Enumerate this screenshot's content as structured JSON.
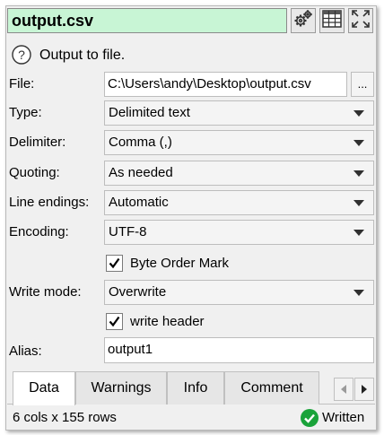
{
  "header": {
    "filename": "output.csv",
    "settings_icon": "gears-icon",
    "table_icon": "table-icon",
    "expand_icon": "expand-icon"
  },
  "info": {
    "help_icon": "question-mark-icon",
    "description": "Output to file."
  },
  "fields": {
    "file": {
      "label": "File:",
      "value": "C:\\Users\\andy\\Desktop\\output.csv",
      "browse_label": "..."
    },
    "type": {
      "label": "Type:",
      "value": "Delimited text"
    },
    "delimiter": {
      "label": "Delimiter:",
      "value": "Comma (,)"
    },
    "quoting": {
      "label": "Quoting:",
      "value": "As needed"
    },
    "line_endings": {
      "label": "Line endings:",
      "value": "Automatic"
    },
    "encoding": {
      "label": "Encoding:",
      "value": "UTF-8"
    },
    "bom": {
      "label": "Byte Order Mark",
      "checked": true
    },
    "write_mode": {
      "label": "Write mode:",
      "value": "Overwrite"
    },
    "write_header": {
      "label": "write header",
      "checked": true
    },
    "alias": {
      "label": "Alias:",
      "value": "output1"
    }
  },
  "tabs": [
    {
      "label": "Data",
      "active": true
    },
    {
      "label": "Warnings",
      "active": false
    },
    {
      "label": "Info",
      "active": false
    },
    {
      "label": "Comment",
      "active": false
    }
  ],
  "status": {
    "dimensions": "6 cols x 155 rows",
    "state": "Written",
    "state_color": "#1aa33a"
  }
}
